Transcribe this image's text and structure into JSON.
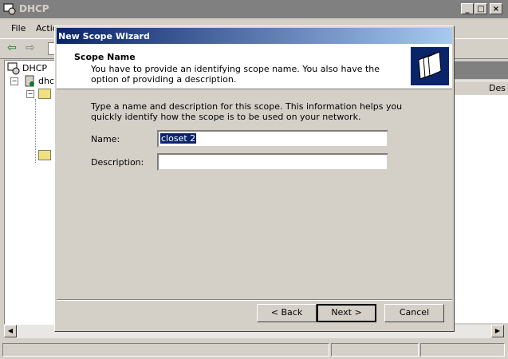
{
  "window": {
    "title": "DHCP",
    "controls": [
      "_",
      "□",
      "×"
    ]
  },
  "menu": [
    {
      "label": "File",
      "access": "F"
    },
    {
      "label": "Actio",
      "access": "A"
    }
  ],
  "tree": {
    "root": "DHCP",
    "server": "dhcp"
  },
  "right_pane": {
    "column_header": "Des"
  },
  "wizard": {
    "title": "New Scope Wizard",
    "header_title": "Scope Name",
    "header_subtitle": "You have to provide an identifying scope name. You also have the option of providing a description.",
    "instructions": "Type a name and description for this scope. This information helps you quickly identify how the scope is to be used on your network.",
    "name_label": "Name:",
    "name_value": "closet 2",
    "description_label": "Description:",
    "description_value": "",
    "back_label": "< Back",
    "next_label": "Next >",
    "cancel_label": "Cancel"
  },
  "icons": {
    "app": "dhcp-console-icon",
    "wizard": "folders-icon"
  }
}
